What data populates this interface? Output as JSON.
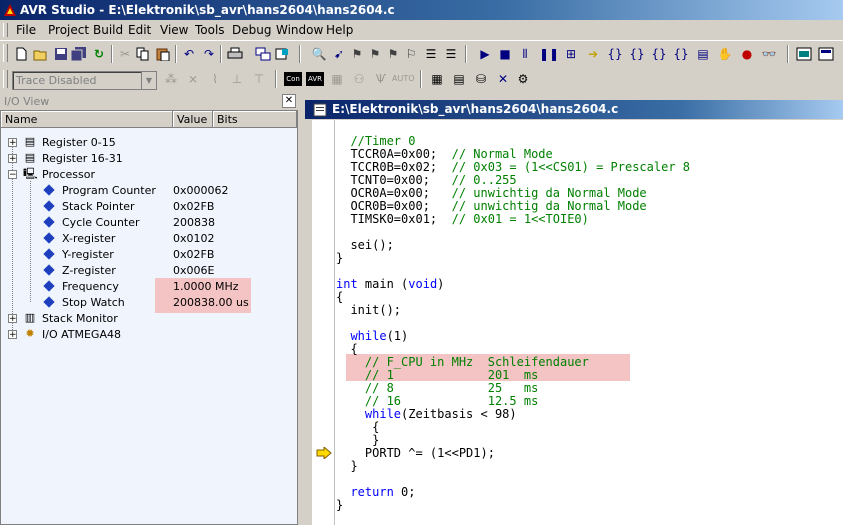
{
  "window": {
    "title": "AVR Studio - E:\\Elektronik\\sb_avr\\hans2604\\hans2604.c"
  },
  "menu": [
    "File",
    "Project",
    "Build",
    "Edit",
    "View",
    "Tools",
    "Debug",
    "Window",
    "Help"
  ],
  "toolbar2": {
    "trace_select": "Trace Disabled",
    "con_label": "Con",
    "avr_label": "AVR",
    "auto_label": "AUTO"
  },
  "io_view": {
    "title": "I/O View",
    "columns": {
      "name": "Name",
      "value": "Value",
      "bits": "Bits"
    },
    "tree": [
      {
        "label": "Register 0-15",
        "value": "",
        "icon": "register-icon"
      },
      {
        "label": "Register 16-31",
        "value": "",
        "icon": "register-icon"
      },
      {
        "label": "Processor",
        "value": "",
        "icon": "processor-icon"
      },
      {
        "label": "Program Counter",
        "value": "0x000062",
        "icon": "item-icon"
      },
      {
        "label": "Stack Pointer",
        "value": "0x02FB",
        "icon": "item-icon"
      },
      {
        "label": "Cycle Counter",
        "value": "200838",
        "icon": "item-icon"
      },
      {
        "label": "X-register",
        "value": "0x0102",
        "icon": "item-icon"
      },
      {
        "label": "Y-register",
        "value": "0x02FB",
        "icon": "item-icon"
      },
      {
        "label": "Z-register",
        "value": "0x006E",
        "icon": "item-icon"
      },
      {
        "label": "Frequency",
        "value": "1.0000 MHz",
        "icon": "item-icon"
      },
      {
        "label": "Stop Watch",
        "value": "200838.00 us",
        "icon": "item-icon"
      },
      {
        "label": "Stack Monitor",
        "value": "",
        "icon": "stack-icon"
      },
      {
        "label": "I/O ATMEGA48",
        "value": "",
        "icon": "chip-icon"
      }
    ]
  },
  "editor": {
    "title": "E:\\Elektronik\\sb_avr\\hans2604\\hans2604.c",
    "lines": [
      {
        "code": "  //Timer 0",
        "comment": ""
      },
      {
        "code": "  TCCR0A=0x00;  ",
        "comment": "// Normal Mode"
      },
      {
        "code": "  TCCR0B=0x02;  ",
        "comment": "// 0x03 = (1<<CS01) = Prescaler 8"
      },
      {
        "code": "  TCNT0=0x00;   ",
        "comment": "// 0..255"
      },
      {
        "code": "  OCR0A=0x00;   ",
        "comment": "// unwichtig da Normal Mode"
      },
      {
        "code": "  OCR0B=0x00;   ",
        "comment": "// unwichtig da Normal Mode"
      },
      {
        "code": "  TIMSK0=0x01;  ",
        "comment": "// 0x01 = 1<<TOIE0)"
      },
      {
        "code": "",
        "comment": ""
      },
      {
        "code": "  sei();",
        "comment": ""
      },
      {
        "code": "}",
        "comment": ""
      },
      {
        "code": "",
        "comment": ""
      },
      {
        "code": "int main (void)",
        "comment": ""
      },
      {
        "code": "{",
        "comment": ""
      },
      {
        "code": "  init();",
        "comment": ""
      },
      {
        "code": "",
        "comment": ""
      },
      {
        "code": "  while(1)",
        "comment": ""
      },
      {
        "code": "  {",
        "comment": ""
      },
      {
        "code": "    ",
        "comment": "// F_CPU in MHz  Schleifendauer"
      },
      {
        "code": "    ",
        "comment": "// 1             201  ms"
      },
      {
        "code": "    ",
        "comment": "// 8             25   ms"
      },
      {
        "code": "    ",
        "comment": "// 16            12.5 ms"
      },
      {
        "code": "    while(Zeitbasis < 98)",
        "comment": ""
      },
      {
        "code": "     {",
        "comment": ""
      },
      {
        "code": "     }",
        "comment": ""
      },
      {
        "code": "    PORTD ^= (1<<PD1);",
        "comment": ""
      },
      {
        "code": "  }",
        "comment": ""
      },
      {
        "code": "",
        "comment": ""
      },
      {
        "code": "  return 0;",
        "comment": ""
      },
      {
        "code": "}",
        "comment": ""
      }
    ]
  },
  "colors": {
    "highlight": "#f4c4c4",
    "comment": "#008000",
    "keyword": "#0000ff",
    "titlebar": "#0a246a"
  }
}
